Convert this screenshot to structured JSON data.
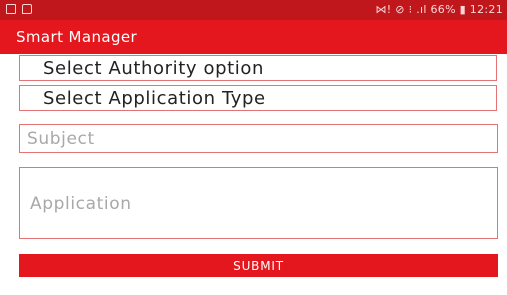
{
  "status_bar": {
    "right_text": "⋈! ⊘ ⁝ .ıl 66% ▮ 12:21",
    "left_icons": [
      "notification-icon",
      "message-icon"
    ]
  },
  "app_bar": {
    "title": "Smart Manager"
  },
  "form": {
    "authority_label": "Select Authority option",
    "application_type_label": "Select Application Type",
    "subject_placeholder": "Subject",
    "application_placeholder": "Application",
    "submit_label": "SUBMIT"
  },
  "colors": {
    "status_bar": "#c0171d",
    "app_bar": "#e3171d",
    "field_border": "#e57373",
    "button": "#e3171d"
  }
}
